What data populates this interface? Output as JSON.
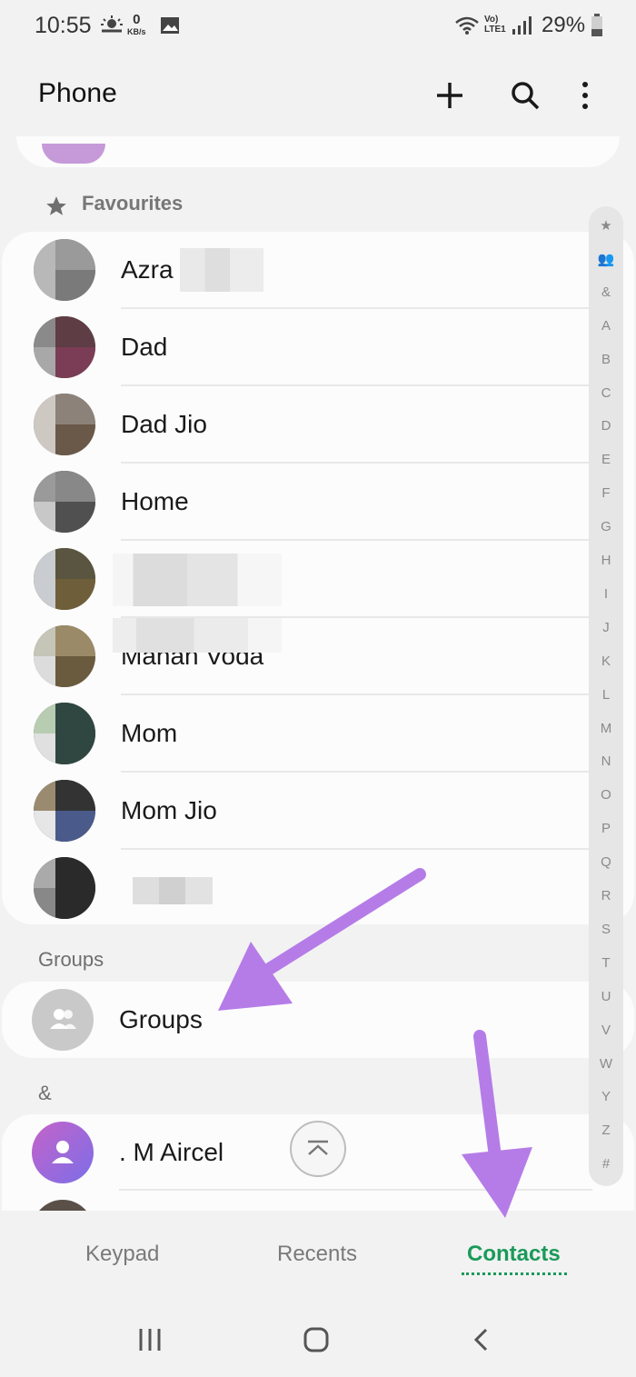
{
  "status_bar": {
    "time": "10:55",
    "net_speed_value": "0",
    "net_speed_unit": "KB/s",
    "network_top": "Vo)",
    "network_bottom": "LTE1",
    "battery": "29%"
  },
  "app_bar": {
    "title": "Phone",
    "add_icon": "plus-icon",
    "search_icon": "search-icon",
    "more_icon": "more-vertical-icon"
  },
  "favourites": {
    "header": "Favourites",
    "contacts": [
      {
        "name": "Azra"
      },
      {
        "name": "Dad"
      },
      {
        "name": "Dad Jio"
      },
      {
        "name": "Home"
      },
      {
        "name": ""
      },
      {
        "name": "Mahan Voda"
      },
      {
        "name": "Mom"
      },
      {
        "name": "Mom Jio"
      },
      {
        "name": ""
      }
    ]
  },
  "groups": {
    "header": "Groups",
    "item_label": "Groups"
  },
  "amp_section": {
    "header": "&",
    "first_contact": ". M Aircel"
  },
  "index_bar": {
    "letters": [
      "★",
      "👥",
      "&",
      "A",
      "B",
      "C",
      "D",
      "E",
      "F",
      "G",
      "H",
      "I",
      "J",
      "K",
      "L",
      "M",
      "N",
      "O",
      "P",
      "Q",
      "R",
      "S",
      "T",
      "U",
      "V",
      "W",
      "Y",
      "Z",
      "#"
    ]
  },
  "bottom_nav": {
    "tabs": [
      {
        "label": "Keypad",
        "active": false
      },
      {
        "label": "Recents",
        "active": false
      },
      {
        "label": "Contacts",
        "active": true
      }
    ]
  },
  "colors": {
    "accent_green": "#1a9a5a",
    "annotation_arrow": "#b57ce8",
    "background": "#f2f2f2"
  }
}
